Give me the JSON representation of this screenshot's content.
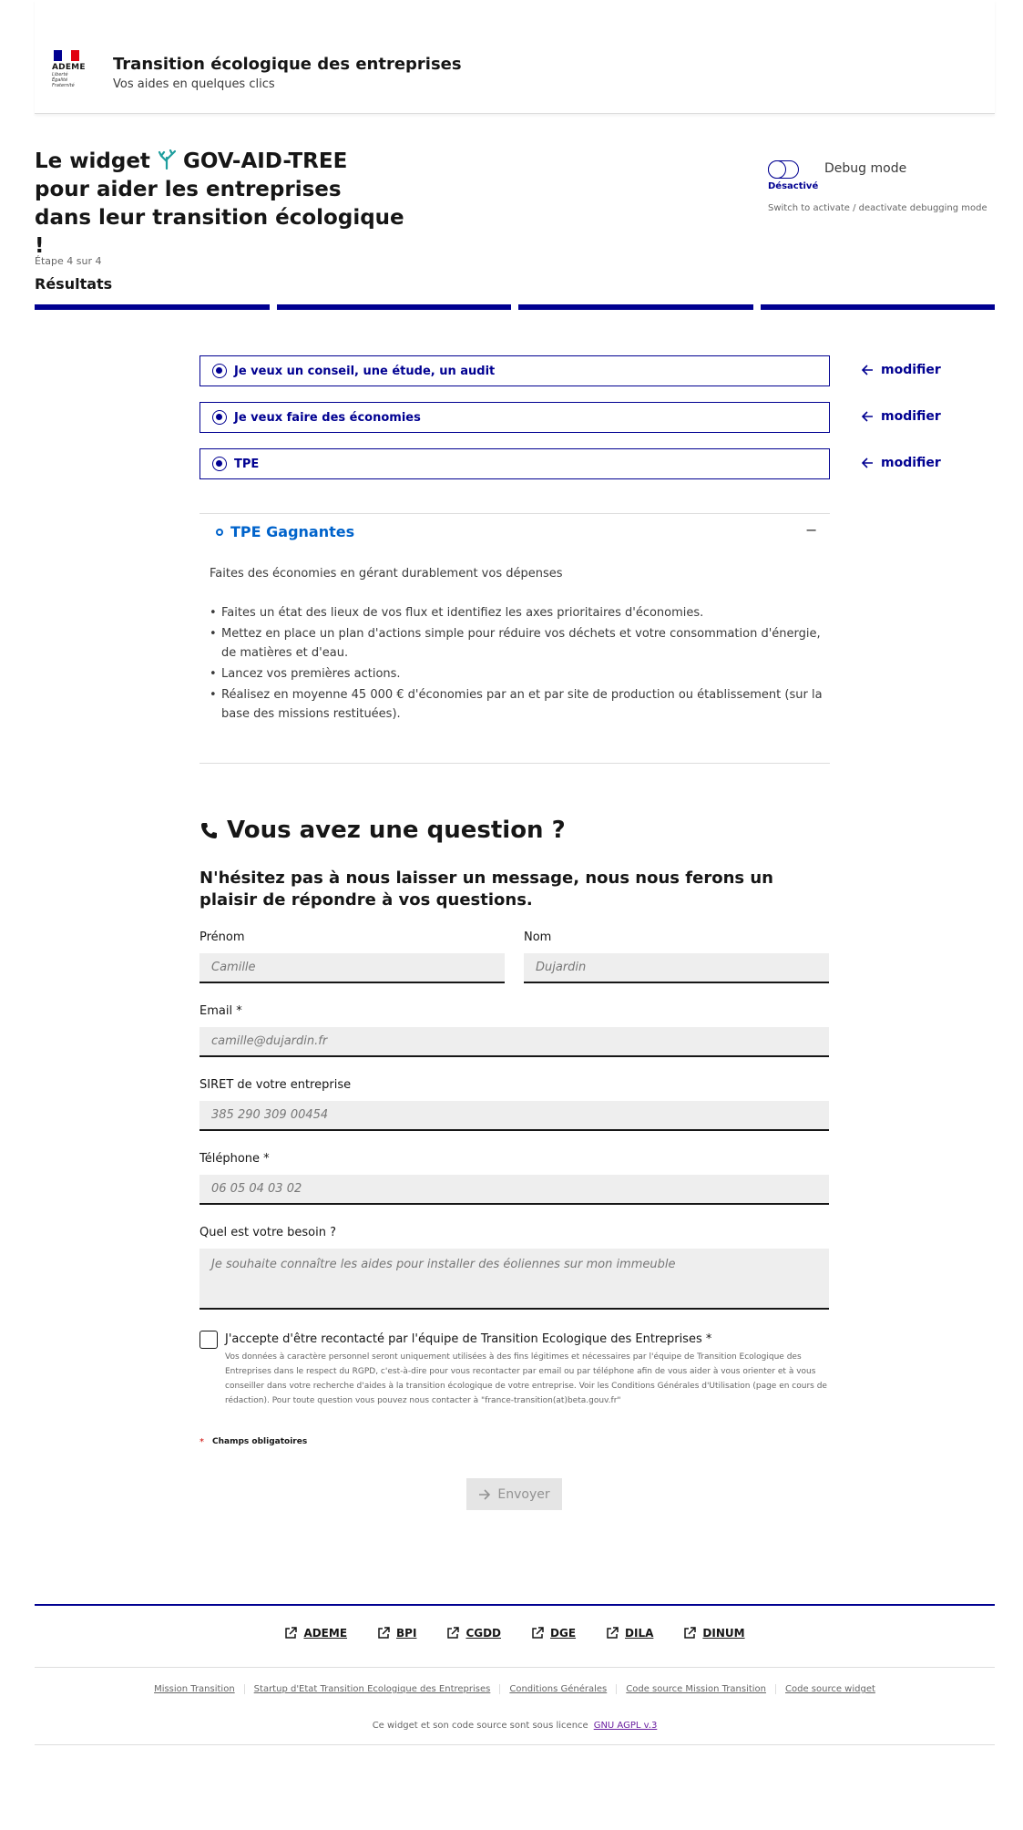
{
  "header": {
    "logo_text": "ADEME",
    "logo_motto": [
      "Liberté",
      "Égalité",
      "Fraternité"
    ],
    "site_title": "Transition écologique des entreprises",
    "site_tagline": "Vos aides en quelques clics"
  },
  "hero": {
    "title_prefix": "Le widget",
    "brand": "GOV-AID-TREE",
    "title_line2": "pour aider les entreprises",
    "title_line3": "dans leur transition écologique !"
  },
  "debug": {
    "label": "Debug mode",
    "state": "Désactivé",
    "help": "Switch to activate / deactivate debugging mode"
  },
  "stepper": {
    "step_count": "Étape 4 sur 4",
    "title": "Résultats",
    "completed_steps": 4,
    "total_steps": 4
  },
  "choices": [
    {
      "label": "Je veux un conseil, une étude, un audit",
      "modify": "modifier"
    },
    {
      "label": "Je veux faire des économies",
      "modify": "modifier"
    },
    {
      "label": "TPE",
      "modify": "modifier"
    }
  ],
  "accordion": {
    "title": "TPE Gagnantes",
    "toggle": "−",
    "description": "Faites des économies en gérant durablement vos dépenses",
    "items": [
      "Faites un état des lieux de vos flux et identifiez les axes prioritaires d'économies.",
      "Mettez en place un plan d'actions simple pour réduire vos déchets et votre consommation d'énergie, de matières et d'eau.",
      "Lancez vos premières actions.",
      "Réalisez en moyenne 45 000 € d'économies par an et par site de production ou établissement (sur la base des missions restituées)."
    ]
  },
  "contact": {
    "title": "Vous avez une question ?",
    "subtitle": "N'hésitez pas à nous laisser un message, nous nous ferons un plaisir de répondre à vos questions.",
    "fields": {
      "firstname": {
        "label": "Prénom",
        "placeholder": "Camille"
      },
      "lastname": {
        "label": "Nom",
        "placeholder": "Dujardin"
      },
      "email": {
        "label": "Email  *",
        "placeholder": "camille@dujardin.fr"
      },
      "siret": {
        "label": "SIRET de votre entreprise",
        "placeholder": "385 290 309 00454"
      },
      "phone": {
        "label": "Téléphone  *",
        "placeholder": "06 05 04 03 02"
      },
      "need": {
        "label": "Quel est votre besoin ?",
        "placeholder": "Je souhaite connaître les aides pour installer des éoliennes sur mon immeuble"
      }
    },
    "consent_label": "J'accepte d'être recontacté par l'équipe de Transition Ecologique des Entreprises *",
    "consent_help": "Vos données à caractère personnel seront uniquement utilisées à des fins légitimes et nécessaires par l'équipe de Transition Ecologique des Entreprises dans le respect du RGPD, c'est-à-dire pour vous recontacter par email ou par téléphone afin de vous aider à vous orienter et à vous conseiller dans votre recherche d'aides à la transition écologique de votre entreprise. Voir les Conditions Générales d'Utilisation (page en cours de rédaction). Pour toute question vous pouvez nous contacter à \"france-transition(at)beta.gouv.fr\"",
    "required_star": "*",
    "required_note": "Champs obligatoires",
    "send": "Envoyer"
  },
  "footer": {
    "partners": [
      "ADEME",
      "BPI",
      "CGDD",
      "DGE",
      "DILA",
      "DINUM"
    ],
    "links": [
      "Mission Transition",
      "Startup d'Etat Transition Ecologique des Entreprises",
      "Conditions Générales",
      "Code source Mission Transition",
      "Code source widget"
    ],
    "license_text": "Ce widget et son code source sont sous licence",
    "license_link": "GNU AGPL v.3"
  },
  "colors": {
    "primary": "#000091",
    "accordion_title": "#0063cb",
    "brand_teal": "#1f9e9e",
    "flag_blue": "#000091",
    "flag_red": "#e1000f"
  }
}
